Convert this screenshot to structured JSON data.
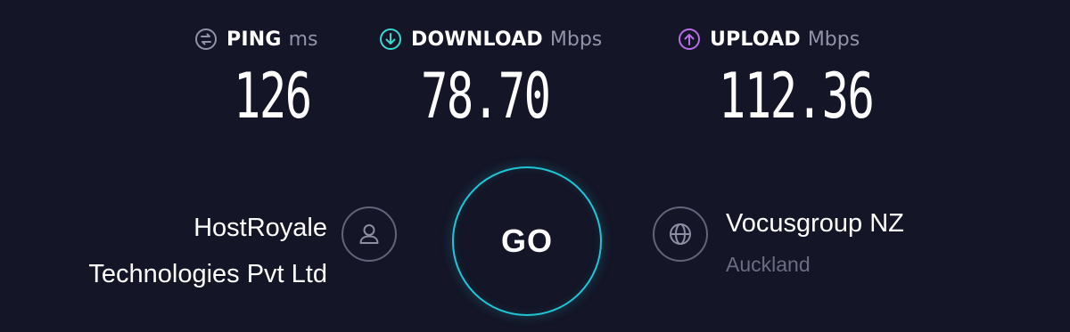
{
  "metrics": {
    "ping": {
      "label": "PING",
      "unit": "ms",
      "value": "126",
      "icon": "ping-icon",
      "color": "#9193a8"
    },
    "download": {
      "label": "DOWNLOAD",
      "unit": "Mbps",
      "value": "78.70",
      "icon": "download-arrow-icon",
      "color": "#38d8d0"
    },
    "upload": {
      "label": "UPLOAD",
      "unit": "Mbps",
      "value": "112.36",
      "icon": "upload-arrow-icon",
      "color": "#b76ee8"
    }
  },
  "provider": {
    "name_line1": "HostRoyale",
    "name_line2": "Technologies Pvt Ltd",
    "icon": "user-icon"
  },
  "go_button": {
    "label": "GO",
    "accent": "#1fc6d8"
  },
  "server": {
    "name": "Vocusgroup NZ",
    "location": "Auckland",
    "icon": "globe-icon"
  },
  "theme": {
    "background": "#141526",
    "muted_text": "#6b6d82"
  }
}
